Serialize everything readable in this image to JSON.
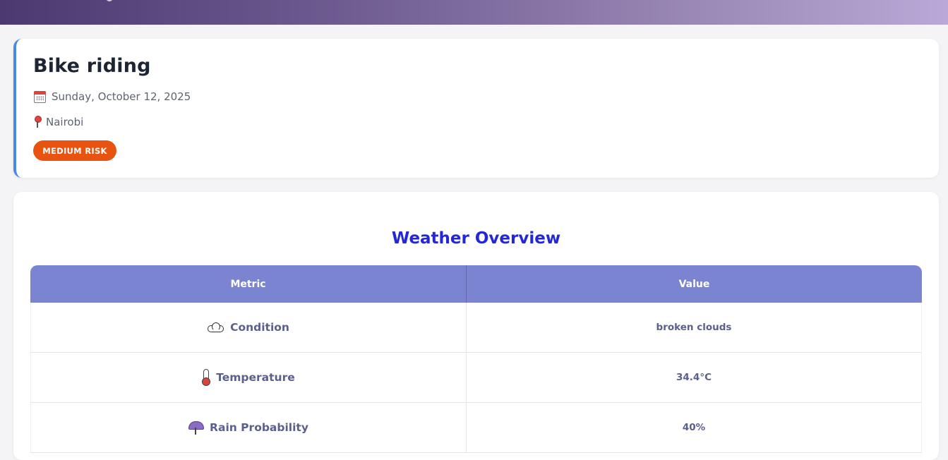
{
  "event": {
    "title": "Bike riding",
    "date": "Sunday, October 12, 2025",
    "location": "Nairobi",
    "risk_label": "MEDIUM RISK",
    "risk_color": "#e8540f",
    "accent_color": "#4a8ae6"
  },
  "weather": {
    "title": "Weather Overview",
    "title_color": "#2426d9",
    "header_color": "#7b84d1",
    "columns": [
      "Metric",
      "Value"
    ],
    "rows": [
      {
        "icon": "cloud-icon",
        "metric": "Condition",
        "value": "broken clouds"
      },
      {
        "icon": "thermometer-icon",
        "metric": "Temperature",
        "value": "34.4°C"
      },
      {
        "icon": "umbrella-rain-icon",
        "metric": "Rain Probability",
        "value": "40%"
      }
    ]
  }
}
